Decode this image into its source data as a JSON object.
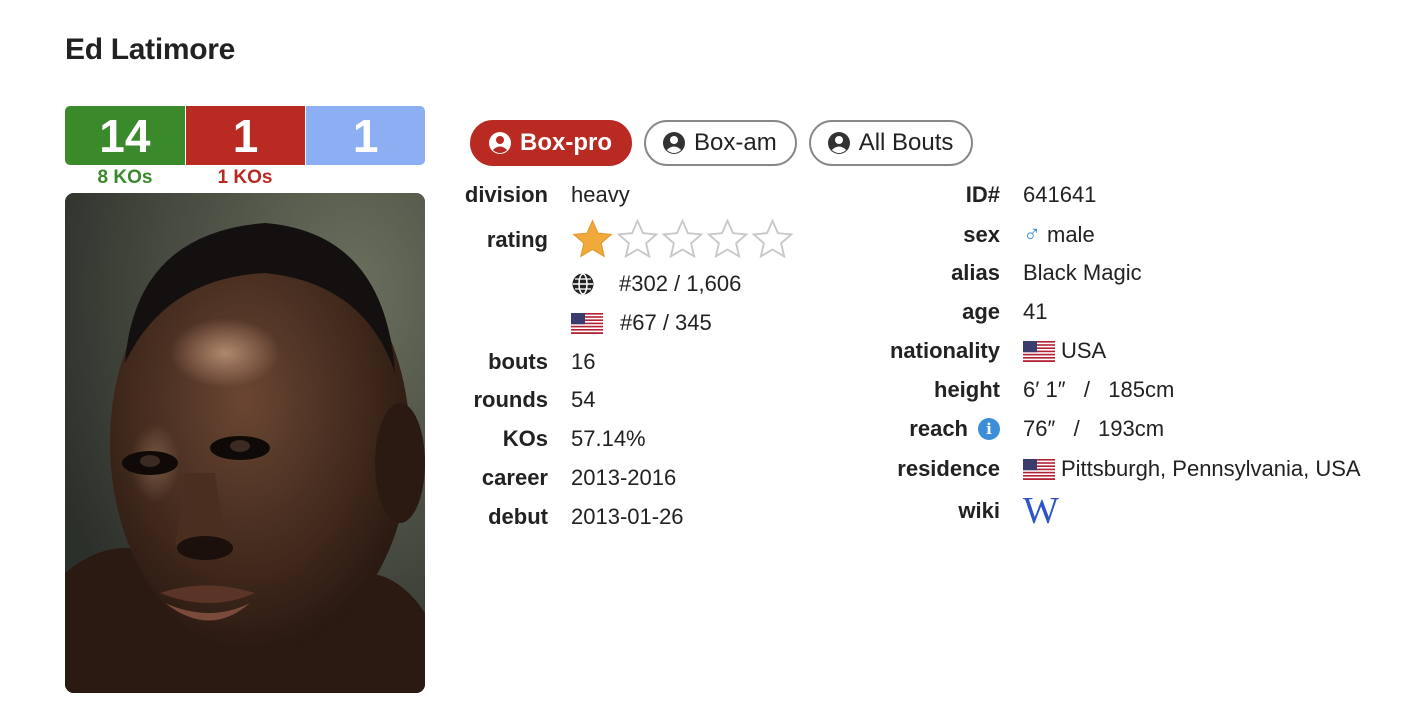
{
  "boxer": {
    "name": "Ed Latimore"
  },
  "record": {
    "wins": "14",
    "losses": "1",
    "draws": "1",
    "win_kos": "8 KOs",
    "loss_kos": "1 KOs"
  },
  "colors": {
    "win": "#3a8a2c",
    "loss": "#b92a22",
    "draw": "#8caef2",
    "star": "#f2a93b",
    "link": "#2d56c8",
    "info": "#3b8ed8"
  },
  "tabs": [
    {
      "label": "Box-pro",
      "active": true,
      "icon": "user-circle-icon"
    },
    {
      "label": "Box-am",
      "active": false,
      "icon": "user-circle-icon"
    },
    {
      "label": "All Bouts",
      "active": false,
      "icon": "user-circle-icon"
    }
  ],
  "left_info": {
    "division": {
      "label": "division",
      "value": "heavy"
    },
    "rating": {
      "label": "rating",
      "stars": 1,
      "max_stars": 5
    },
    "world_rank": {
      "icon": "globe-icon",
      "value": "#302 / 1,606"
    },
    "country_rank": {
      "icon": "us-flag-icon",
      "value": "#67 / 345"
    },
    "bouts": {
      "label": "bouts",
      "value": "16"
    },
    "rounds": {
      "label": "rounds",
      "value": "54"
    },
    "kos": {
      "label": "KOs",
      "value": "57.14%"
    },
    "career": {
      "label": "career",
      "value": "2013-2016"
    },
    "debut": {
      "label": "debut",
      "value": "2013-01-26"
    }
  },
  "right_info": {
    "id": {
      "label": "ID#",
      "value": "641641"
    },
    "sex": {
      "label": "sex",
      "value": "male",
      "icon": "male-symbol-icon"
    },
    "alias": {
      "label": "alias",
      "value": "Black Magic"
    },
    "age": {
      "label": "age",
      "value": "41"
    },
    "nationality": {
      "label": "nationality",
      "value": "USA",
      "icon": "us-flag-icon"
    },
    "height": {
      "label": "height",
      "value": "6′ 1″   /   185cm"
    },
    "reach": {
      "label": "reach",
      "value": "76″   /   193cm",
      "icon": "info-icon"
    },
    "residence": {
      "label": "residence",
      "value": "Pittsburgh, Pennsylvania, USA",
      "icon": "us-flag-icon"
    },
    "wiki": {
      "label": "wiki",
      "icon": "wikipedia-icon",
      "glyph": "W"
    }
  }
}
